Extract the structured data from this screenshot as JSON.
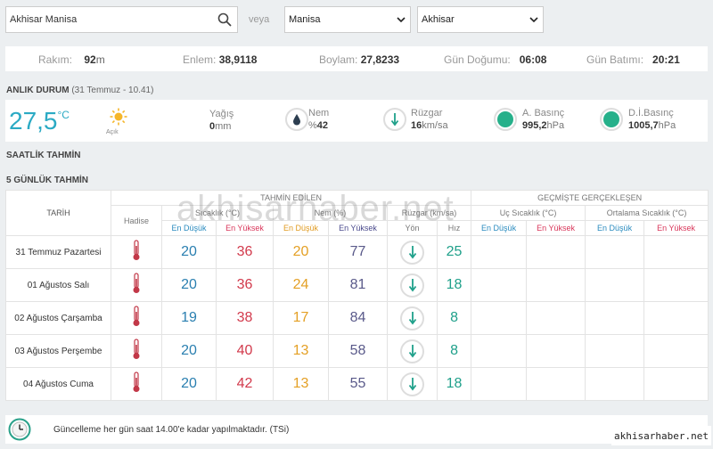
{
  "search": {
    "value": "Akhisar Manisa"
  },
  "veya": "veya",
  "il": {
    "selected": "Manisa"
  },
  "ilce": {
    "selected": "Akhisar"
  },
  "info": {
    "rakim_label": "Rakım:",
    "rakim_value": "92",
    "rakim_unit": "m",
    "enlem_label": "Enlem:",
    "enlem_value": "38,9118",
    "boylam_label": "Boylam:",
    "boylam_value": "27,8233",
    "dogumu_label": "Gün Doğumu:",
    "dogumu_value": "06:08",
    "batimi_label": "Gün Batımı:",
    "batimi_value": "20:21"
  },
  "current": {
    "title": "ANLIK DURUM",
    "subtitle": "(31 Temmuz - 10.41)",
    "temp": "27,5",
    "temp_unit": "°C",
    "condition": "Açık",
    "yagis_label": "Yağış",
    "yagis_value": "0",
    "yagis_unit": "mm",
    "nem_label": "Nem",
    "nem_prefix": "%",
    "nem_value": "42",
    "ruzgar_label": "Rüzgar",
    "ruzgar_value": "16",
    "ruzgar_unit": "km/sa",
    "abasinc_label": "A. Basınç",
    "abasinc_value": "995,2",
    "abasinc_unit": "hPa",
    "dibasinc_label": "D.İ.Basınç",
    "dibasinc_value": "1005,7",
    "dibasinc_unit": "hPa"
  },
  "saatlik_title": "SAATLİK TAHMİN",
  "gunluk_title": "5 GÜNLÜK TAHMİN",
  "table": {
    "h_tarih": "TARİH",
    "h_tahmin": "TAHMİN EDİLEN",
    "h_gecmis": "GEÇMİŞTE GERÇEKLEŞEN",
    "h_hadise": "Hadise",
    "h_sicaklik": "Sıcaklık (°C)",
    "h_nem": "Nem (%)",
    "h_ruzgar": "Rüzgar (km/sa)",
    "h_uc": "Uç Sıcaklık (°C)",
    "h_ort": "Ortalama Sıcaklık (°C)",
    "en_dusuk": "En Düşük",
    "en_yuksek": "En Yüksek",
    "yon": "Yön",
    "hiz": "Hız",
    "rows": [
      {
        "date": "31 Temmuz Pazartesi",
        "t_low": "20",
        "t_high": "36",
        "n_low": "20",
        "n_high": "77",
        "wind": "25"
      },
      {
        "date": "01 Ağustos Salı",
        "t_low": "20",
        "t_high": "36",
        "n_low": "24",
        "n_high": "81",
        "wind": "18"
      },
      {
        "date": "02 Ağustos Çarşamba",
        "t_low": "19",
        "t_high": "38",
        "n_low": "17",
        "n_high": "84",
        "wind": "8"
      },
      {
        "date": "03 Ağustos Perşembe",
        "t_low": "20",
        "t_high": "40",
        "n_low": "13",
        "n_high": "58",
        "wind": "8"
      },
      {
        "date": "04 Ağustos Cuma",
        "t_low": "20",
        "t_high": "42",
        "n_low": "13",
        "n_high": "55",
        "wind": "18"
      }
    ]
  },
  "footer": {
    "note": "Güncelleme her gün saat 14.00'e kadar yapılmaktadır. (TSi)"
  },
  "watermark": "akhisarhaber.net",
  "watermark_badge": "akhisarhaber.net"
}
